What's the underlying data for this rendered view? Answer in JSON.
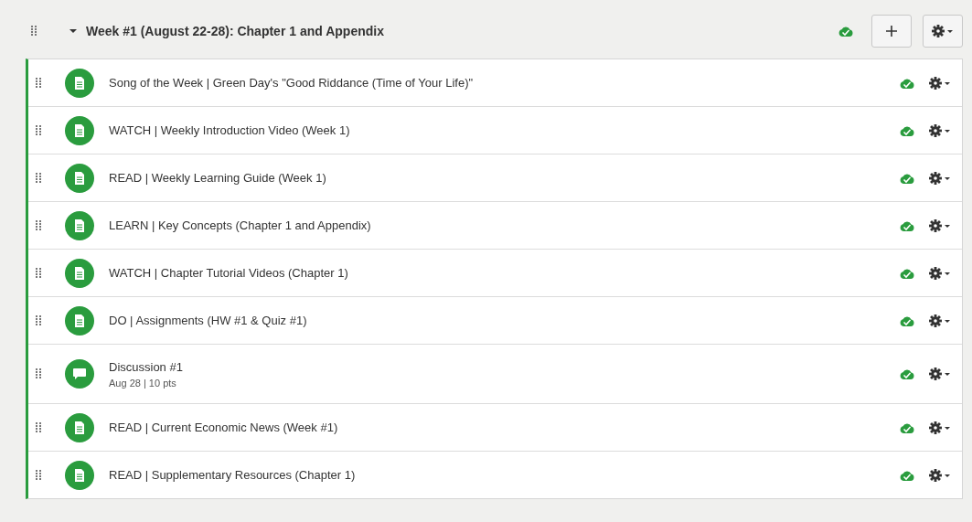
{
  "module": {
    "title": "Week #1 (August 22-28): Chapter 1 and Appendix",
    "expanded": true,
    "published": true
  },
  "items": [
    {
      "kind": "page",
      "title": "Song of the Week | Green Day's \"Good Riddance (Time of Your Life)\"",
      "published": true
    },
    {
      "kind": "page",
      "title": "WATCH | Weekly Introduction Video (Week 1)",
      "published": true
    },
    {
      "kind": "page",
      "title": "READ | Weekly Learning Guide (Week 1)",
      "published": true
    },
    {
      "kind": "page",
      "title": "LEARN | Key Concepts (Chapter 1 and Appendix)",
      "published": true
    },
    {
      "kind": "page",
      "title": "WATCH | Chapter Tutorial Videos (Chapter 1)",
      "published": true
    },
    {
      "kind": "page",
      "title": "DO | Assignments (HW #1 & Quiz #1)",
      "published": true
    },
    {
      "kind": "discussion",
      "title": "Discussion #1",
      "details": "Aug 28 | 10 pts",
      "published": true
    },
    {
      "kind": "page",
      "title": "READ | Current Economic News (Week #1)",
      "published": true
    },
    {
      "kind": "page",
      "title": "READ | Supplementary Resources (Chapter 1)",
      "published": true
    }
  ]
}
